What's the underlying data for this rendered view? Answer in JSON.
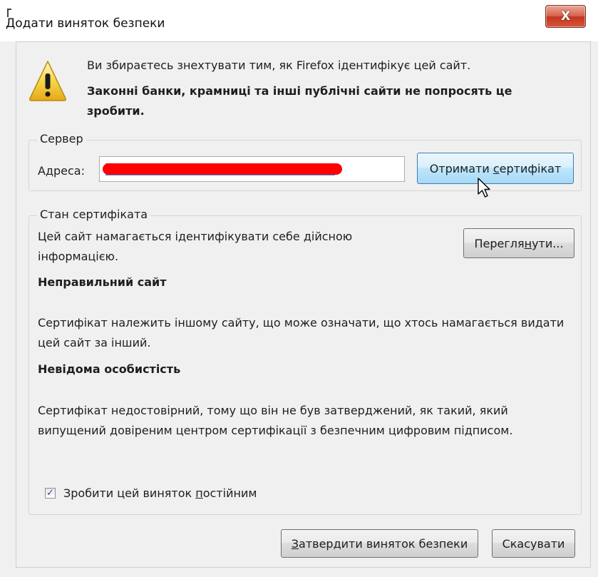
{
  "window": {
    "title": "Додати виняток безпеки",
    "close_label": "X"
  },
  "intro": {
    "line1": "Ви збираєтесь знехтувати тим, як Firefox ідентифікує цей сайт.",
    "line2": "Законні банки, крамниці та інші публічні сайти не попросять це зробити."
  },
  "server": {
    "legend": "Сервер",
    "address_label": "Адреса:",
    "address_value": "",
    "get_cert_prefix": "Отримати ",
    "get_cert_mnemonic": "с",
    "get_cert_suffix": "ертифікат"
  },
  "cert_status": {
    "legend": "Стан сертифіката",
    "status_text": "Цей сайт намагається ідентифікувати себе дійсною інформацією.",
    "view_prefix": "Перегля",
    "view_mnemonic": "н",
    "view_suffix": "ути...",
    "wrong_site_title": "Неправильний сайт",
    "wrong_site_desc": "Сертифікат належить іншому сайту, що може означати, що хтось намагається видати цей сайт за інший.",
    "unknown_identity_title": "Невідома особистість",
    "unknown_identity_desc": "Сертифікат недостовірний, тому що він не був затверджений, як такий, який випущений довіреним центром сертифікації з безпечним цифровим підписом."
  },
  "permanent": {
    "checked": true,
    "label_prefix": "Зробити цей виняток ",
    "label_mnemonic": "п",
    "label_suffix": "остійним"
  },
  "footer": {
    "confirm_mnemonic": "З",
    "confirm_rest": "атвердити виняток безпеки",
    "cancel_label": "Скасувати"
  },
  "icons": {
    "warning": "warning-icon",
    "cursor": "mouse-pointer-icon",
    "check": "checkmark-icon"
  },
  "colors": {
    "redaction": "#ff0000",
    "selection": "#3399ff",
    "close_button": "#c3361f",
    "hover_button": "#bee6fd"
  }
}
